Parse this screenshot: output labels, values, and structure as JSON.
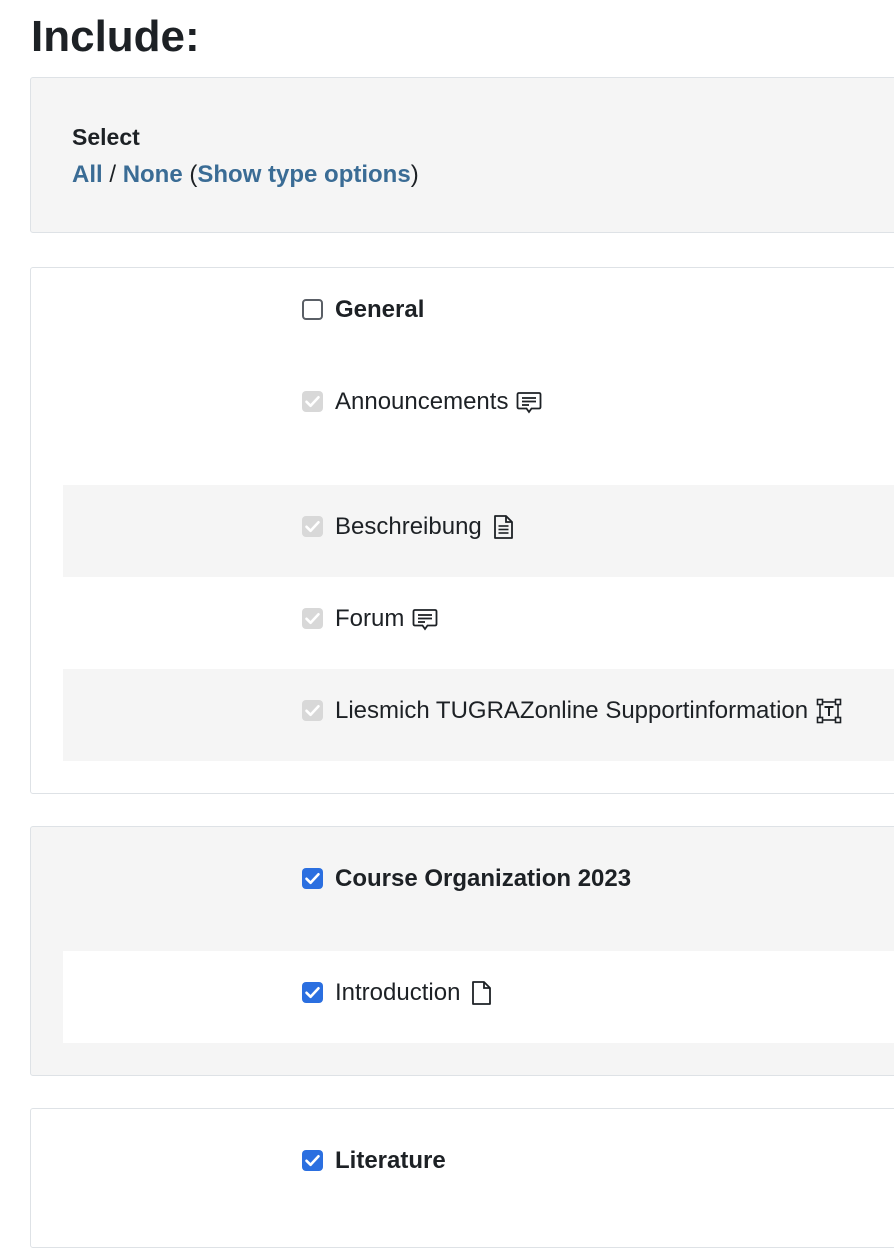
{
  "page_title": "Include:",
  "select": {
    "label": "Select",
    "all": "All",
    "separator": "/",
    "none": "None",
    "open_paren": "(",
    "show_type_options": "Show type options",
    "close_paren": ")"
  },
  "sections": [
    {
      "name": "General",
      "checked": false,
      "items": [
        {
          "label": "Announcements",
          "icon": "forum-icon",
          "checked": true,
          "disabled": true
        },
        {
          "label": "Beschreibung",
          "icon": "page-icon",
          "checked": true,
          "disabled": true
        },
        {
          "label": "Forum",
          "icon": "forum-icon",
          "checked": true,
          "disabled": true
        },
        {
          "label": "Liesmich TUGRAZonline Supportinformation",
          "icon": "text-label-icon",
          "checked": true,
          "disabled": true
        }
      ]
    },
    {
      "name": "Course Organization 2023",
      "checked": true,
      "items": [
        {
          "label": "Introduction",
          "icon": "file-icon",
          "checked": true,
          "disabled": false
        }
      ]
    },
    {
      "name": "Literature",
      "checked": true,
      "items": []
    }
  ],
  "colors": {
    "link": "#3a6c95",
    "checkbox_checked": "#2b6fe0",
    "checkbox_disabled": "#d8d8d8",
    "panel_grey": "#f5f5f5"
  }
}
